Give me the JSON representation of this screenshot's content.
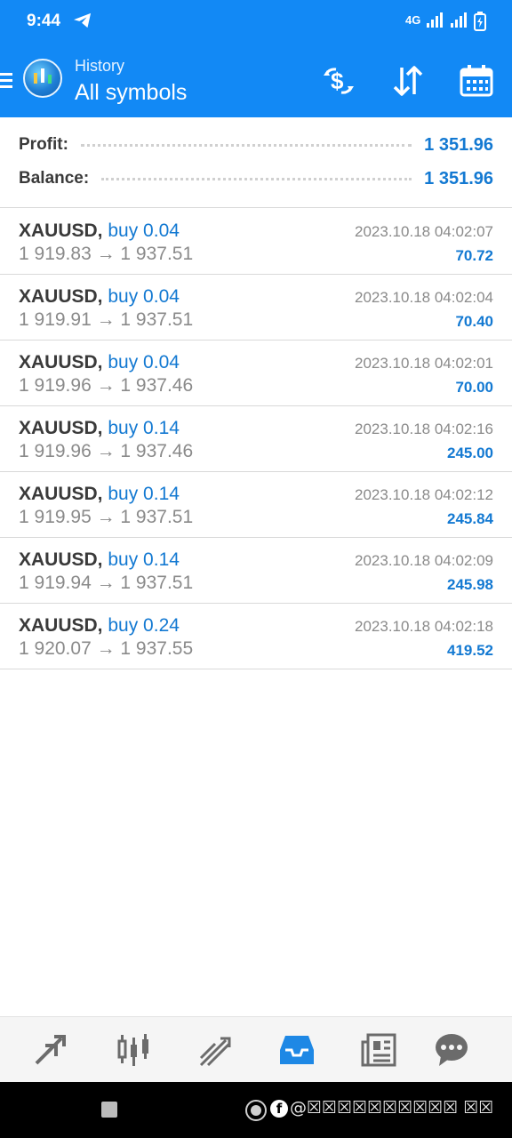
{
  "status_bar": {
    "time": "9:44",
    "network": "4G"
  },
  "header": {
    "subtitle": "History",
    "title": "All symbols"
  },
  "summary": {
    "profit_label": "Profit:",
    "profit_value": "1 351.96",
    "balance_label": "Balance:",
    "balance_value": "1 351.96"
  },
  "deals": [
    {
      "symbol": "XAUUSD,",
      "type": "buy 0.04",
      "prices": "1 919.83 → 1 937.51",
      "time": "2023.10.18 04:02:07",
      "profit": "70.72"
    },
    {
      "symbol": "XAUUSD,",
      "type": "buy 0.04",
      "prices": "1 919.91 → 1 937.51",
      "time": "2023.10.18 04:02:04",
      "profit": "70.40"
    },
    {
      "symbol": "XAUUSD,",
      "type": "buy 0.04",
      "prices": "1 919.96 → 1 937.46",
      "time": "2023.10.18 04:02:01",
      "profit": "70.00"
    },
    {
      "symbol": "XAUUSD,",
      "type": "buy 0.14",
      "prices": "1 919.96 → 1 937.46",
      "time": "2023.10.18 04:02:16",
      "profit": "245.00"
    },
    {
      "symbol": "XAUUSD,",
      "type": "buy 0.14",
      "prices": "1 919.95 → 1 937.51",
      "time": "2023.10.18 04:02:12",
      "profit": "245.84"
    },
    {
      "symbol": "XAUUSD,",
      "type": "buy 0.14",
      "prices": "1 919.94 → 1 937.51",
      "time": "2023.10.18 04:02:09",
      "profit": "245.98"
    },
    {
      "symbol": "XAUUSD,",
      "type": "buy 0.24",
      "prices": "1 920.07 → 1 937.55",
      "time": "2023.10.18 04:02:18",
      "profit": "419.52"
    }
  ],
  "bottom_nav": {
    "items": [
      "quotes-icon",
      "chart-icon",
      "trade-icon",
      "history-icon",
      "news-icon",
      "chat-icon"
    ],
    "active": "history-icon"
  },
  "watermark": {
    "text": "@☒☒☒☒☒☒☒☒☒☒ ☒☒"
  },
  "colors": {
    "header": "#1289f5",
    "accent_blue": "#1379d2",
    "text_dark": "#3a3a3a",
    "text_grey": "#8a8a8a",
    "nav_active": "#1e88e5",
    "nav_inactive": "#6b6b6b"
  }
}
